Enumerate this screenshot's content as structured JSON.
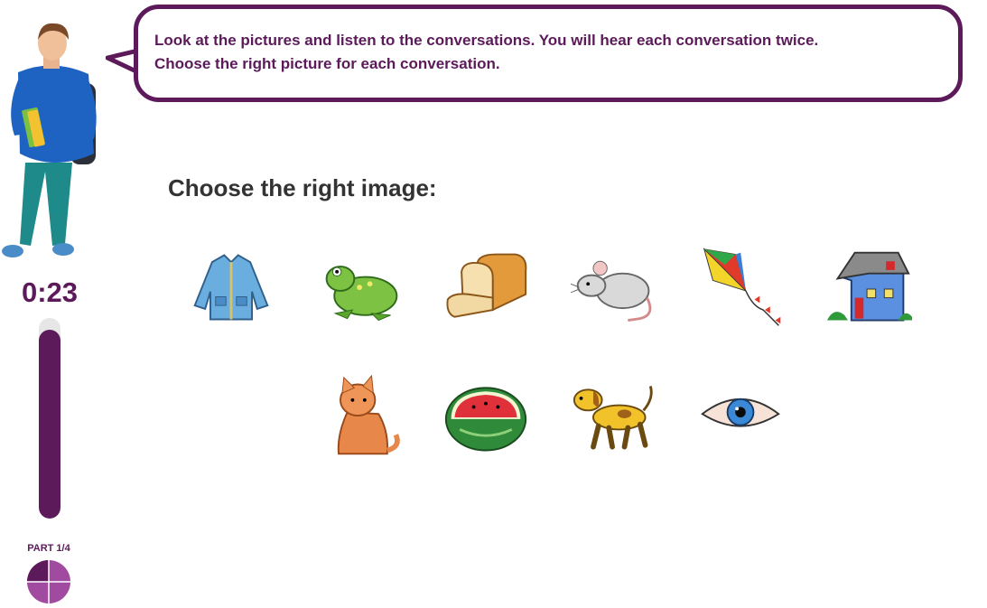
{
  "instructions": {
    "line1": "Look at the pictures and listen to the conversations. You will hear each conversation twice.",
    "line2": "Choose the right picture for each conversation."
  },
  "timer": {
    "text": "0:23",
    "progress_fraction": 0.94
  },
  "part": {
    "label": "PART 1/4",
    "current": 1,
    "total": 4
  },
  "question": {
    "title": "Choose the right image:"
  },
  "options": [
    {
      "icon": "jacket-icon"
    },
    {
      "icon": "frog-icon"
    },
    {
      "icon": "bread-icon"
    },
    {
      "icon": "mouse-icon"
    },
    {
      "icon": "kite-icon"
    },
    {
      "icon": "house-icon"
    },
    {
      "icon": "cat-icon"
    },
    {
      "icon": "watermelon-icon"
    },
    {
      "icon": "dog-icon"
    },
    {
      "icon": "eye-icon"
    }
  ],
  "colors": {
    "brand_purple": "#5c1a5a",
    "part_purple": "#a04aa0",
    "track_gray": "#e6e6e6",
    "heading_gray": "#333333"
  }
}
